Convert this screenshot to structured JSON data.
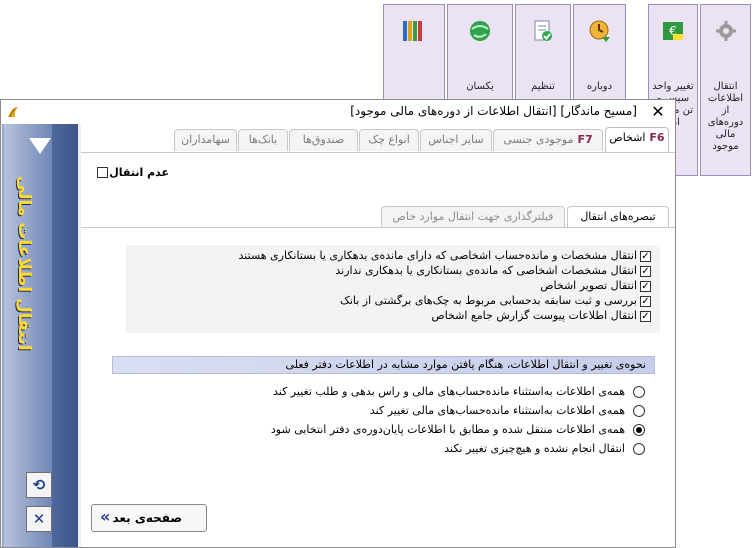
{
  "ribbon": [
    {
      "label": "",
      "icon": "book-binders-icon"
    },
    {
      "label": "یکسان",
      "icon": "globe-icon"
    },
    {
      "label": "تنظیم",
      "icon": "document-check-icon"
    },
    {
      "label": "دوباره",
      "icon": "clock-arrow-icon"
    },
    {
      "label": "تغییر واحد سیس و تن ما اس اطا",
      "icon": "currency-change-icon"
    },
    {
      "label": "انتقال اطلاعات از دوره‌های مالی موجود",
      "icon": "gear-icon"
    }
  ],
  "window": {
    "title": "[مسیح ماندگار] [انتقال اطلاعات از دوره‌های مالی موجود]",
    "close_label": "✕"
  },
  "sidebar": {
    "title": "انتقال اطلاعات مالی",
    "undo_label": "⟲",
    "cancel_label": "✕"
  },
  "tabs": [
    {
      "label": "اشخاص",
      "key": "F6",
      "active": true
    },
    {
      "label": "موجودی جنسی",
      "key": "F7",
      "active": false
    },
    {
      "label": "سایر اجناس",
      "key": "",
      "active": false
    },
    {
      "label": "انواع چک",
      "key": "",
      "active": false
    },
    {
      "label": "صندوق‌ها",
      "key": "",
      "active": false
    },
    {
      "label": "بانک‌ها",
      "key": "",
      "active": false
    },
    {
      "label": "سهامداران",
      "key": "",
      "active": false
    }
  ],
  "no_transfer": {
    "label": "عدم انتقال",
    "checked": false
  },
  "subtabs": [
    {
      "label": "تبصره‌های انتقال",
      "active": true
    },
    {
      "label": "فیلترگذاری جهت انتقال موارد خاص",
      "active": false
    }
  ],
  "options": [
    {
      "label": "انتقال مشخصات و مانده‌حساب اشخاصی که دارای مانده‌ی بدهکاری یا بستانکاری هستند",
      "checked": true
    },
    {
      "label": "انتقال مشخصات اشخاصی که مانده‌ی بستانکاری یا بدهکاری ندارند",
      "checked": true
    },
    {
      "label": "انتقال تصویر اشخاص",
      "checked": true
    },
    {
      "label": "بررسی و ثبت سابقه بدحسابی مربوط به چک‌های برگشتی از بانک",
      "checked": true
    },
    {
      "label": "انتقال اطلاعات پیوست گزارش جامع اشخاص",
      "checked": true
    }
  ],
  "change_section": {
    "title": "نحوه‌ی تغییر و انتقال اطلاعات،  هنگام یافتن موارد مشابه در اطلاعات دفتر فعلی"
  },
  "radios": [
    {
      "label": "همه‌ی اطلاعات به‌استثناء مانده‌حساب‌های مالی و راس بدهی و طلب تغییر کند",
      "selected": false
    },
    {
      "label": "همه‌ی اطلاعات به‌استثناء مانده‌حساب‌های مالی تغییر کند",
      "selected": false
    },
    {
      "label": "همه‌ی اطلاعات منتقل شده و مطابق با اطلاعات پایان‌دوره‌ی دفتر انتخابی شود",
      "selected": true
    },
    {
      "label": "انتقال انجام نشده و هیچ‌چیزی تغییر نکند",
      "selected": false
    }
  ],
  "next_button": {
    "label": "صفحه‌ی بعد",
    "icon": "double-chevron-left-icon"
  }
}
